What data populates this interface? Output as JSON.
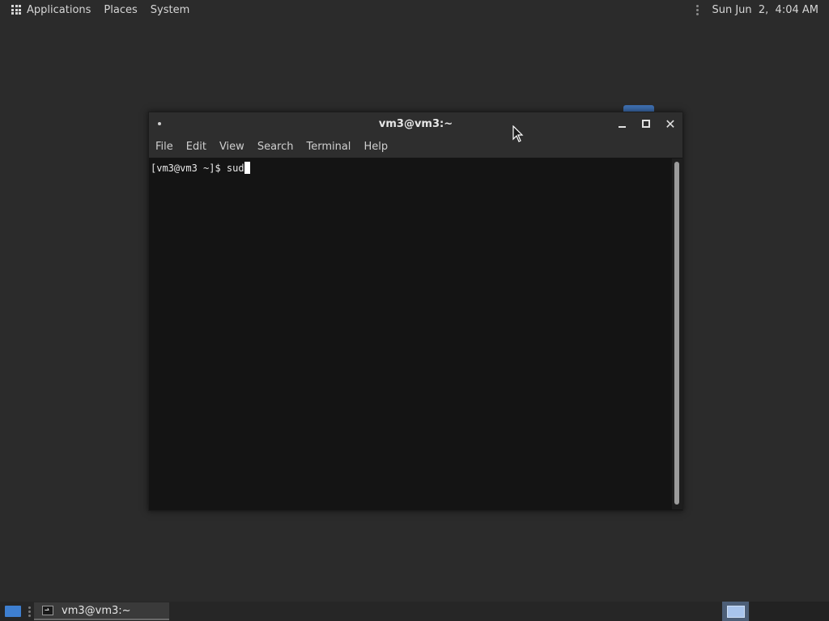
{
  "top_panel": {
    "menus": [
      "Applications",
      "Places",
      "System"
    ],
    "clock": "Sun Jun  2,  4:04 AM",
    "apps_icon": "apps-grid-icon"
  },
  "window": {
    "title": "vm3@vm3:~",
    "menubar": [
      "File",
      "Edit",
      "View",
      "Search",
      "Terminal",
      "Help"
    ],
    "close_glyph": "✕"
  },
  "terminal": {
    "prompt": "[vm3@vm3 ~]$ ",
    "input": "sud"
  },
  "taskbar": {
    "task_label": "vm3@vm3:~",
    "task_icon": "terminal-icon"
  },
  "colors": {
    "panel_bg": "#2b2b2b",
    "terminal_bg": "#141414",
    "accent": "#3e7fd0"
  }
}
